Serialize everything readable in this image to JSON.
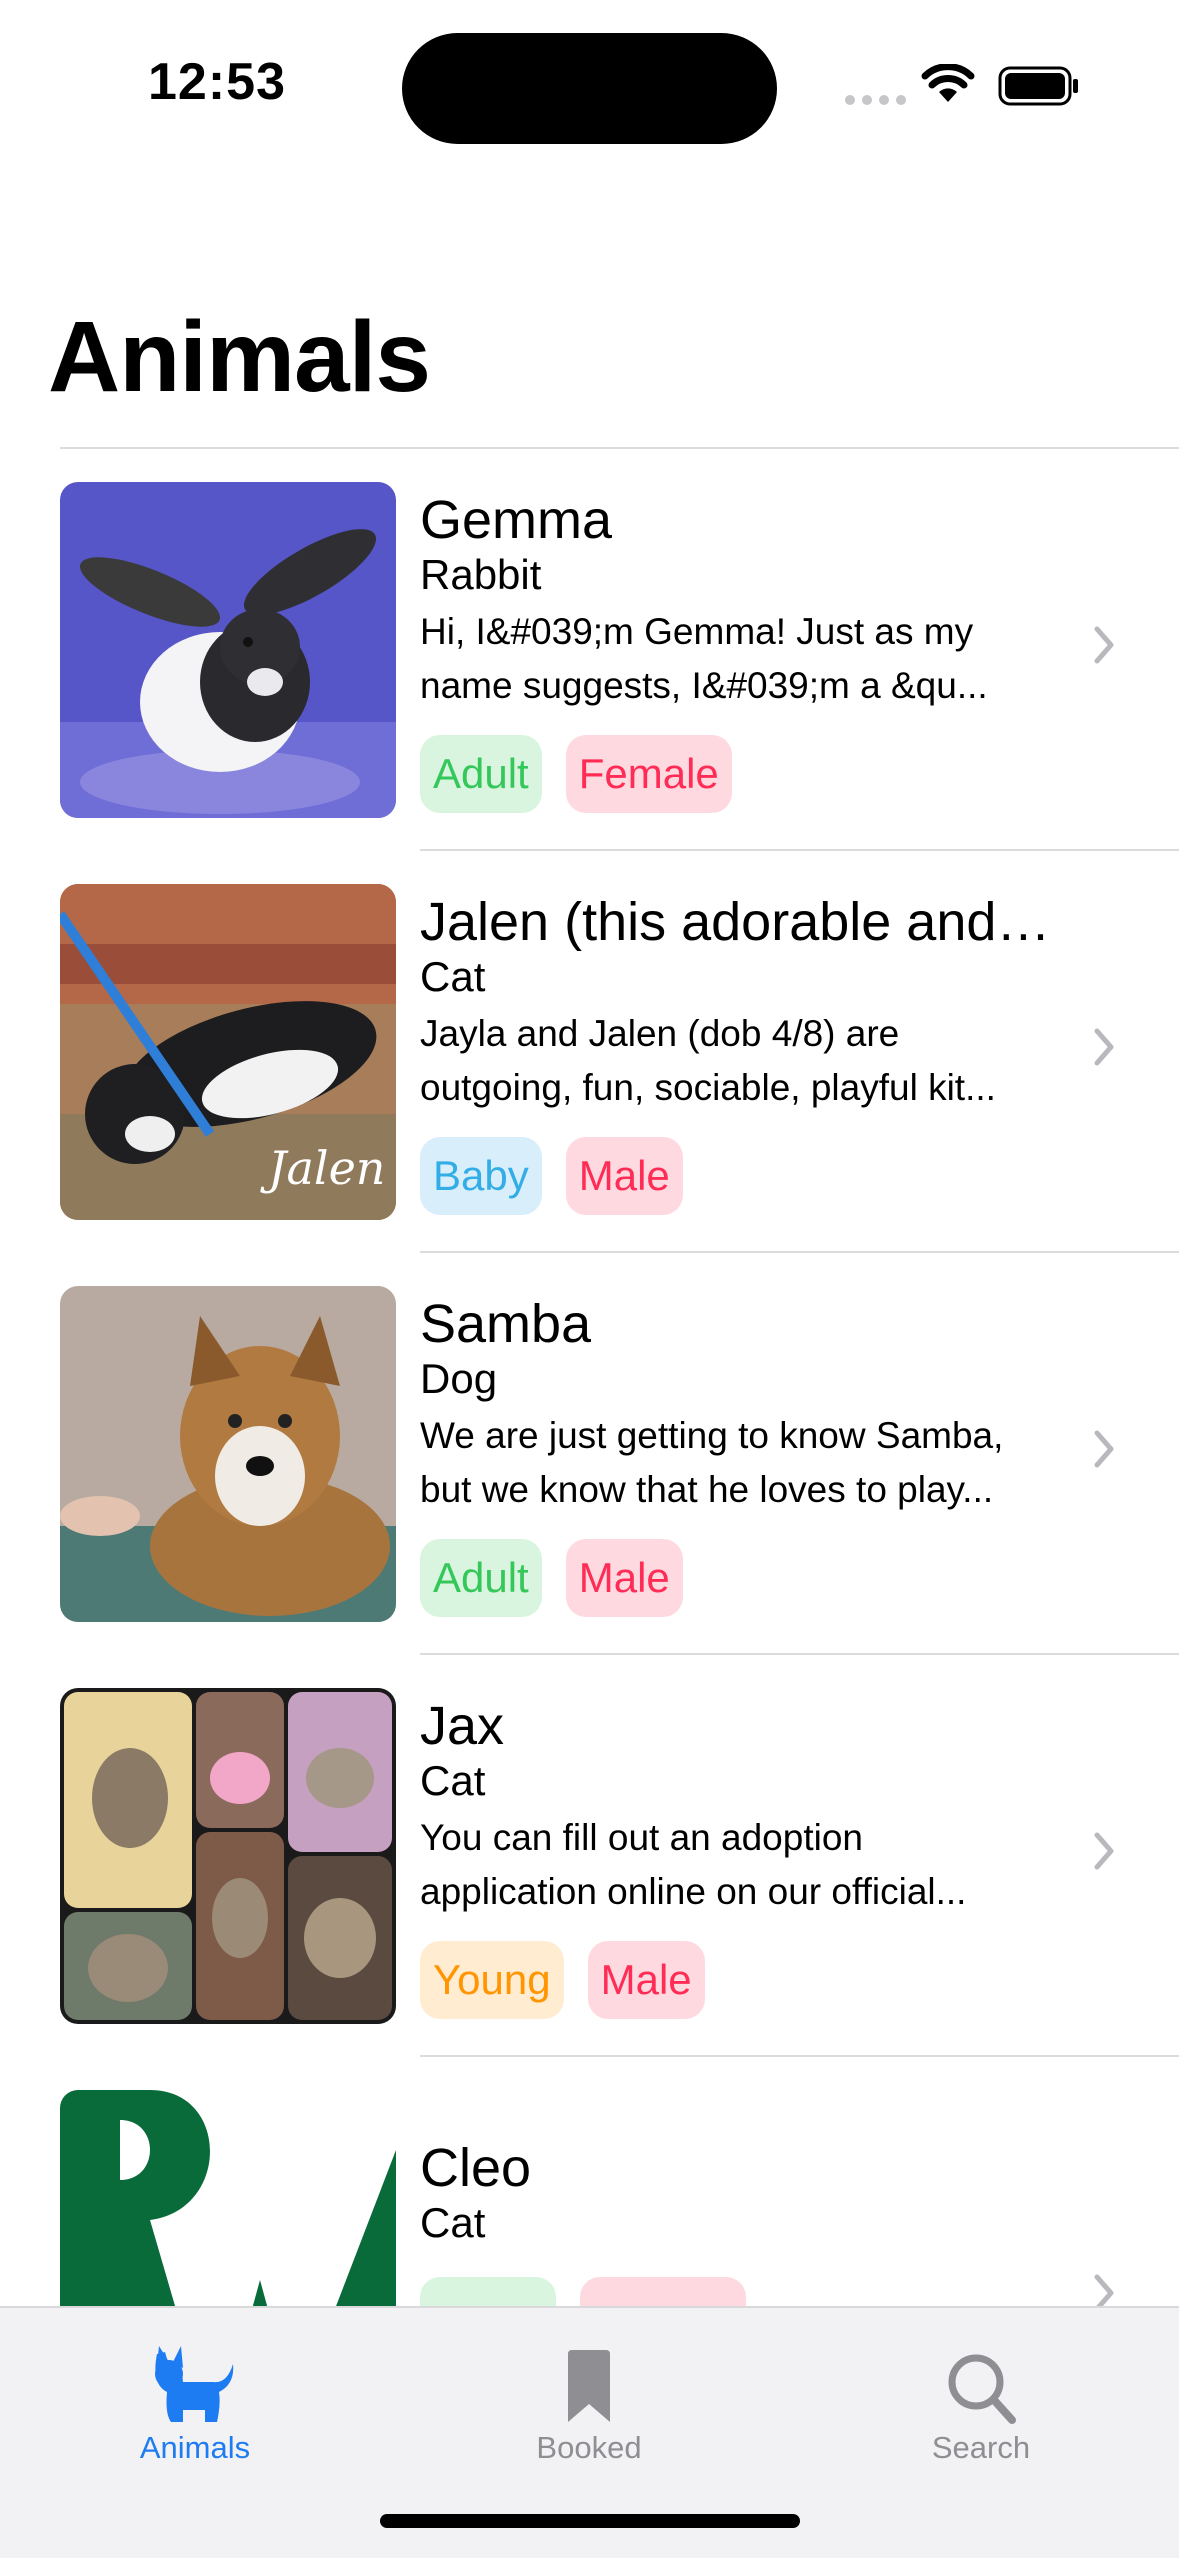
{
  "status_bar": {
    "time": "12:53"
  },
  "page": {
    "title": "Animals"
  },
  "animals": [
    {
      "name": "Gemma",
      "species": "Rabbit",
      "description_lines": [
        "Hi, I&#039;m Gemma! Just as my",
        "name suggests, I&#039;m a &qu..."
      ],
      "tags": [
        {
          "label": "Adult",
          "color": "#34c759",
          "bg": "#d9f5df"
        },
        {
          "label": "Female",
          "color": "#ff2d55",
          "bg": "#ffd9e0"
        }
      ]
    },
    {
      "name": "Jalen (this adorable and…",
      "species": "Cat",
      "description_lines": [
        "Jayla and Jalen (dob 4/8) are",
        "outgoing, fun, sociable, playful kit..."
      ],
      "photo_caption": "Jalen",
      "tags": [
        {
          "label": "Baby",
          "color": "#32ade6",
          "bg": "#d8eefb"
        },
        {
          "label": "Male",
          "color": "#ff2d55",
          "bg": "#ffd9e0"
        }
      ]
    },
    {
      "name": "Samba",
      "species": "Dog",
      "description_lines": [
        "We are just getting to know Samba,",
        "but we know that he loves to play..."
      ],
      "tags": [
        {
          "label": "Adult",
          "color": "#34c759",
          "bg": "#d9f5df"
        },
        {
          "label": "Male",
          "color": "#ff2d55",
          "bg": "#ffd9e0"
        }
      ]
    },
    {
      "name": "Jax",
      "species": "Cat",
      "description_lines": [
        "You can fill out an adoption",
        "application online on our official..."
      ],
      "tags": [
        {
          "label": "Young",
          "color": "#ff9500",
          "bg": "#ffecd1"
        },
        {
          "label": "Male",
          "color": "#ff2d55",
          "bg": "#ffd9e0"
        }
      ]
    },
    {
      "name": "Cleo",
      "species": "Cat",
      "description_lines": [],
      "tags": [
        {
          "label": "",
          "color": "#34c759",
          "bg": "#d9f5df"
        },
        {
          "label": "",
          "color": "#ff2d55",
          "bg": "#ffd9e0"
        }
      ]
    }
  ],
  "tab_bar": {
    "tabs": [
      {
        "label": "Animals",
        "icon": "cat-icon",
        "active": true
      },
      {
        "label": "Booked",
        "icon": "bookmark-icon",
        "active": false
      },
      {
        "label": "Search",
        "icon": "search-icon",
        "active": false
      }
    ],
    "active_color": "#1e7cf2",
    "inactive_color": "#8e8e93"
  }
}
